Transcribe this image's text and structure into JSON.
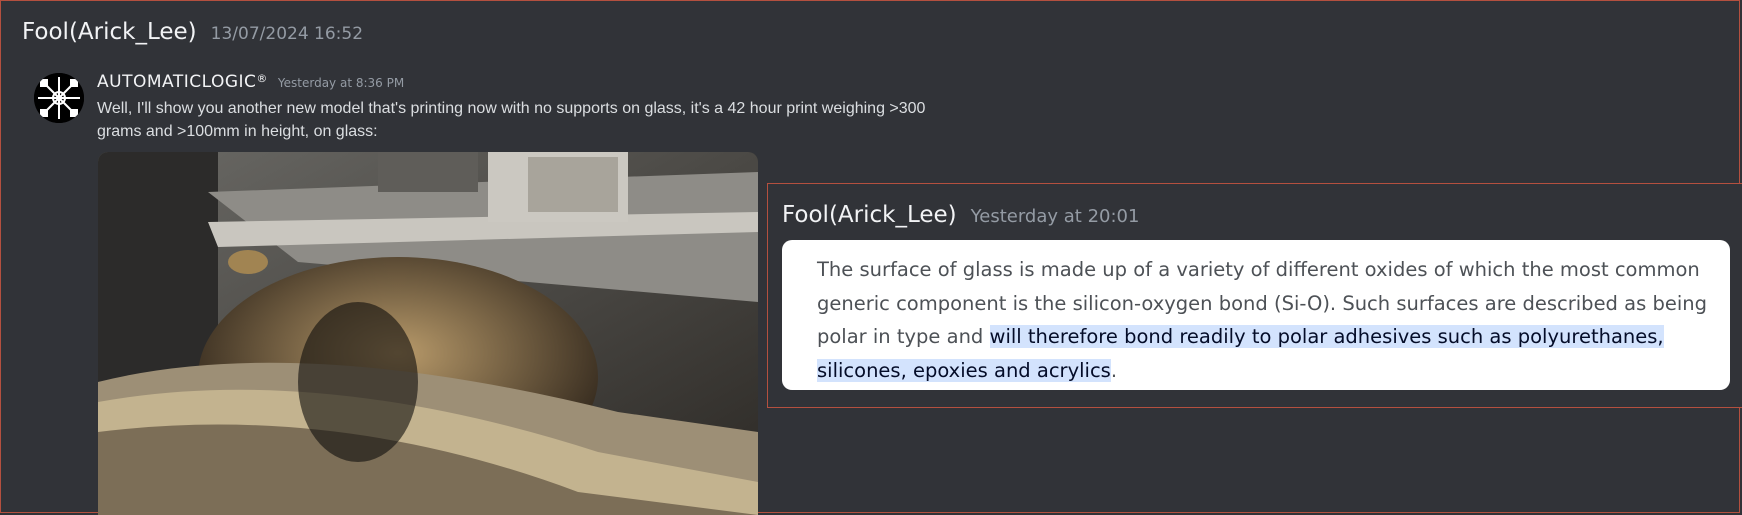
{
  "outer_message": {
    "author": "Fool(Arick_Lee)",
    "timestamp": "13/07/2024 16:52"
  },
  "embedded_message": {
    "author": "AUTOMATICLOGIC",
    "author_mark": "®",
    "timestamp": "Yesterday at 8:36 PM",
    "text": "Well, I'll show you another new model that's printing now with no supports on glass, it's a 42 hour print weighing >300 grams and >100mm in height, on glass:",
    "attachment_icon": "photo-of-3d-printer-icon"
  },
  "quoted_reply": {
    "author": "Fool(Arick_Lee)",
    "timestamp": "Yesterday at 20:01",
    "text_plain": "The surface of glass is made up of a variety of different oxides of which the most common generic component is the silicon-oxygen bond (Si-O). Such surfaces are described as being polar in type and ",
    "text_highlighted": "will therefore bond readily to polar adhesives such as polyurethanes, silicones, epoxies and acrylics",
    "text_end": "."
  },
  "colors": {
    "background": "#313338",
    "border_accent": "#b4503f",
    "highlight": "#d3e3fd"
  }
}
